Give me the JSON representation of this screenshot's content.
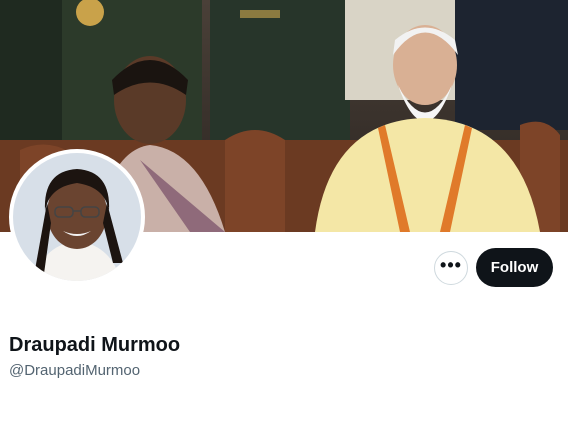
{
  "profile": {
    "display_name": "Draupadi Murmoo",
    "handle": "@DraupadiMurmoo"
  },
  "actions": {
    "more_label": "•••",
    "follow_label": "Follow"
  },
  "colors": {
    "follow_bg": "#0f1419",
    "follow_text": "#ffffff",
    "handle_text": "#536471",
    "name_text": "#0f1419"
  }
}
